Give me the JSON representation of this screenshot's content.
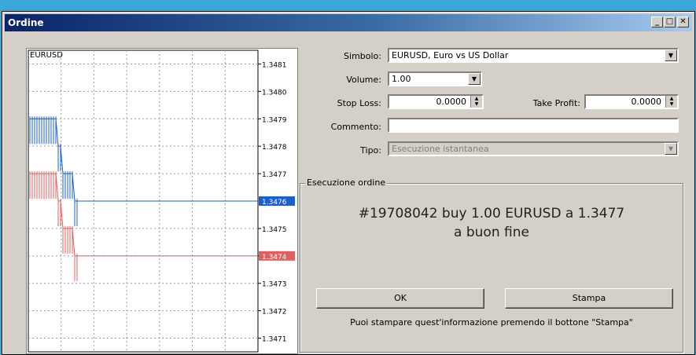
{
  "window": {
    "title": "Ordine",
    "controls": {
      "minimize": "_",
      "maximize": "□",
      "close": "✕"
    }
  },
  "chart": {
    "symbol": "EURUSD",
    "price_ticks": [
      "1.3481",
      "1.3480",
      "1.3479",
      "1.3478",
      "1.3477",
      "1.3475",
      "1.3474",
      "1.3473",
      "1.3472",
      "1.3471"
    ],
    "ask_price": "1.3476",
    "bid_price": "1.3474",
    "ask_color": "#1a5fd0",
    "bid_color": "#e06060"
  },
  "chart_data": {
    "type": "line",
    "ylim": [
      1.34705,
      1.34815
    ],
    "series": [
      {
        "name": "Ask",
        "x": [
          0,
          1,
          2,
          3,
          4,
          5,
          6,
          7,
          8,
          9,
          10,
          11,
          12,
          13,
          14,
          15,
          16,
          17,
          18,
          19,
          20
        ],
        "values": [
          1.3479,
          1.3479,
          1.3479,
          1.3479,
          1.3479,
          1.3479,
          1.3479,
          1.3479,
          1.3479,
          1.3479,
          1.3479,
          1.3479,
          1.3478,
          1.3478,
          1.3477,
          1.3477,
          1.3477,
          1.3477,
          1.3477,
          1.3476,
          1.3476
        ]
      },
      {
        "name": "Bid",
        "x": [
          0,
          1,
          2,
          3,
          4,
          5,
          6,
          7,
          8,
          9,
          10,
          11,
          12,
          13,
          14,
          15,
          16,
          17,
          18,
          19,
          20
        ],
        "values": [
          1.3477,
          1.3477,
          1.3477,
          1.3477,
          1.3477,
          1.3477,
          1.3477,
          1.3477,
          1.3477,
          1.3477,
          1.3477,
          1.3477,
          1.3476,
          1.3476,
          1.3475,
          1.3475,
          1.3475,
          1.3475,
          1.3475,
          1.3474,
          1.3474
        ]
      }
    ]
  },
  "form": {
    "symbol_label": "Simbolo:",
    "symbol_value": "EURUSD, Euro vs US Dollar",
    "volume_label": "Volume:",
    "volume_value": "1.00",
    "stoploss_label": "Stop Loss:",
    "stoploss_value": "0.0000",
    "takeprofit_label": "Take Profit:",
    "takeprofit_value": "0.0000",
    "comment_label": "Commento:",
    "comment_value": "",
    "type_label": "Tipo:",
    "type_value": "Esecuzione istantanea"
  },
  "execution": {
    "group_label": "Esecuzione ordine",
    "message_line1": "#19708042 buy 1.00 EURUSD a 1.3477",
    "message_line2": "a buon fine",
    "ok_label": "OK",
    "print_label": "Stampa",
    "note": "Puoi stampare quest'informazione premendo il bottone \"Stampa\""
  }
}
